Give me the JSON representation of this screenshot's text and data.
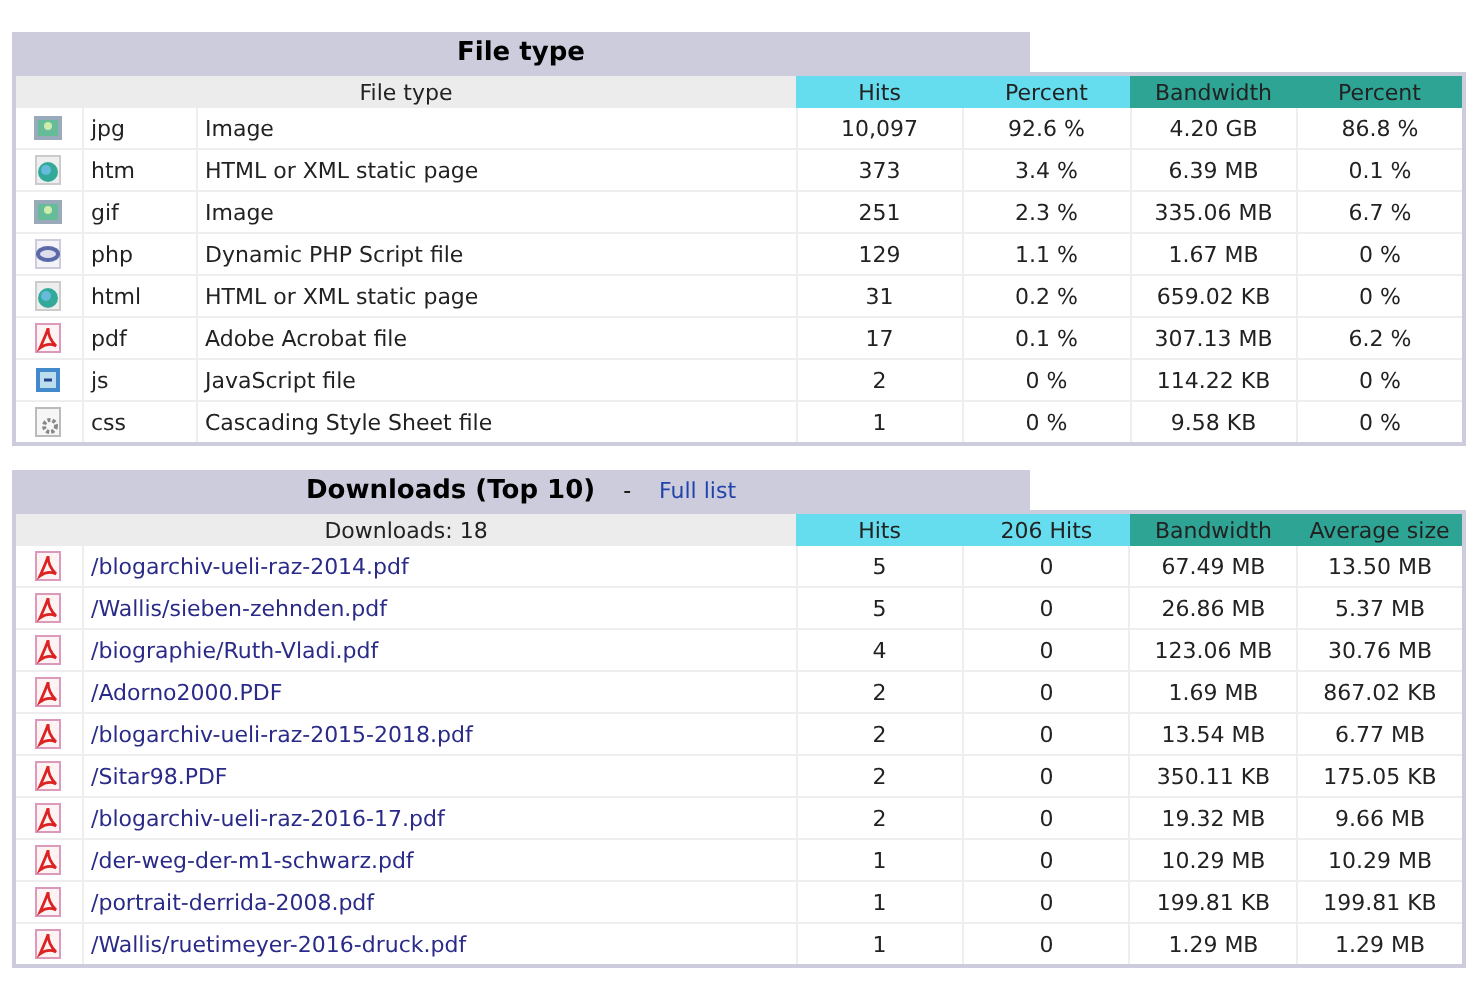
{
  "file_types": {
    "title": "File type",
    "columns": [
      {
        "label": "File type",
        "kind": "label"
      },
      {
        "label": "Hits",
        "kind": "hits"
      },
      {
        "label": "Percent",
        "kind": "hits"
      },
      {
        "label": "Bandwidth",
        "kind": "bandwidth"
      },
      {
        "label": "Percent",
        "kind": "bandwidth"
      }
    ],
    "rows": [
      {
        "kind": "image",
        "ext": "jpg",
        "description": "Image",
        "hits": "10,097",
        "hits_percent": "92.6 %",
        "bandwidth": "4.20 GB",
        "bandwidth_percent": "86.8 %"
      },
      {
        "kind": "web",
        "ext": "htm",
        "description": "HTML or XML static page",
        "hits": "373",
        "hits_percent": "3.4 %",
        "bandwidth": "6.39 MB",
        "bandwidth_percent": "0.1 %"
      },
      {
        "kind": "image",
        "ext": "gif",
        "description": "Image",
        "hits": "251",
        "hits_percent": "2.3 %",
        "bandwidth": "335.06 MB",
        "bandwidth_percent": "6.7 %"
      },
      {
        "kind": "php",
        "ext": "php",
        "description": "Dynamic PHP Script file",
        "hits": "129",
        "hits_percent": "1.1 %",
        "bandwidth": "1.67 MB",
        "bandwidth_percent": "0 %"
      },
      {
        "kind": "web",
        "ext": "html",
        "description": "HTML or XML static page",
        "hits": "31",
        "hits_percent": "0.2 %",
        "bandwidth": "659.02 KB",
        "bandwidth_percent": "0 %"
      },
      {
        "kind": "pdf",
        "ext": "pdf",
        "description": "Adobe Acrobat file",
        "hits": "17",
        "hits_percent": "0.1 %",
        "bandwidth": "307.13 MB",
        "bandwidth_percent": "6.2 %"
      },
      {
        "kind": "script",
        "ext": "js",
        "description": "JavaScript file",
        "hits": "2",
        "hits_percent": "0 %",
        "bandwidth": "114.22 KB",
        "bandwidth_percent": "0 %"
      },
      {
        "kind": "style",
        "ext": "css",
        "description": "Cascading Style Sheet file",
        "hits": "1",
        "hits_percent": "0 %",
        "bandwidth": "9.58 KB",
        "bandwidth_percent": "0 %"
      }
    ]
  },
  "downloads": {
    "title": "Downloads (Top 10)",
    "separator": "-",
    "link": "Full list",
    "columns": [
      {
        "label": "Downloads: 18",
        "kind": "label"
      },
      {
        "label": "Hits",
        "kind": "hits"
      },
      {
        "label": "206 Hits",
        "kind": "hits"
      },
      {
        "label": "Bandwidth",
        "kind": "bandwidth"
      },
      {
        "label": "Average size",
        "kind": "bandwidth"
      }
    ],
    "rows": [
      {
        "kind": "pdf",
        "path": "/blogarchiv-ueli-raz-2014.pdf",
        "hits": "5",
        "hits_206": "0",
        "bandwidth": "67.49 MB",
        "average": "13.50 MB"
      },
      {
        "kind": "pdf",
        "path": "/Wallis/sieben-zehnden.pdf",
        "hits": "5",
        "hits_206": "0",
        "bandwidth": "26.86 MB",
        "average": "5.37 MB"
      },
      {
        "kind": "pdf",
        "path": "/biographie/Ruth-Vladi.pdf",
        "hits": "4",
        "hits_206": "0",
        "bandwidth": "123.06 MB",
        "average": "30.76 MB"
      },
      {
        "kind": "pdf",
        "path": "/Adorno2000.PDF",
        "hits": "2",
        "hits_206": "0",
        "bandwidth": "1.69 MB",
        "average": "867.02 KB"
      },
      {
        "kind": "pdf",
        "path": "/blogarchiv-ueli-raz-2015-2018.pdf",
        "hits": "2",
        "hits_206": "0",
        "bandwidth": "13.54 MB",
        "average": "6.77 MB"
      },
      {
        "kind": "pdf",
        "path": "/Sitar98.PDF",
        "hits": "2",
        "hits_206": "0",
        "bandwidth": "350.11 KB",
        "average": "175.05 KB"
      },
      {
        "kind": "pdf",
        "path": "/blogarchiv-ueli-raz-2016-17.pdf",
        "hits": "2",
        "hits_206": "0",
        "bandwidth": "19.32 MB",
        "average": "9.66 MB"
      },
      {
        "kind": "pdf",
        "path": "/der-weg-der-m1-schwarz.pdf",
        "hits": "1",
        "hits_206": "0",
        "bandwidth": "10.29 MB",
        "average": "10.29 MB"
      },
      {
        "kind": "pdf",
        "path": "/portrait-derrida-2008.pdf",
        "hits": "1",
        "hits_206": "0",
        "bandwidth": "199.81 KB",
        "average": "199.81 KB"
      },
      {
        "kind": "pdf",
        "path": "/Wallis/ruetimeyer-2016-druck.pdf",
        "hits": "1",
        "hits_206": "0",
        "bandwidth": "1.29 MB",
        "average": "1.29 MB"
      }
    ]
  }
}
